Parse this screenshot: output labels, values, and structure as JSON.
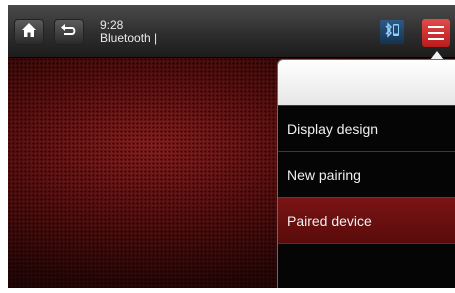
{
  "status": {
    "time": "9:28",
    "source": "Bluetooth |"
  },
  "icons": {
    "home": "home-icon",
    "back": "back-icon",
    "bluetooth": "bluetooth-phone-icon",
    "menu": "hamburger-menu-icon"
  },
  "menu": {
    "items": [
      {
        "label": "Display design",
        "selected": false
      },
      {
        "label": "New pairing",
        "selected": false
      },
      {
        "label": "Paired device",
        "selected": true
      }
    ]
  },
  "colors": {
    "accent": "#cc2b2b",
    "selected_row": "#6a1010",
    "bluetooth_badge": "#1f4770"
  }
}
